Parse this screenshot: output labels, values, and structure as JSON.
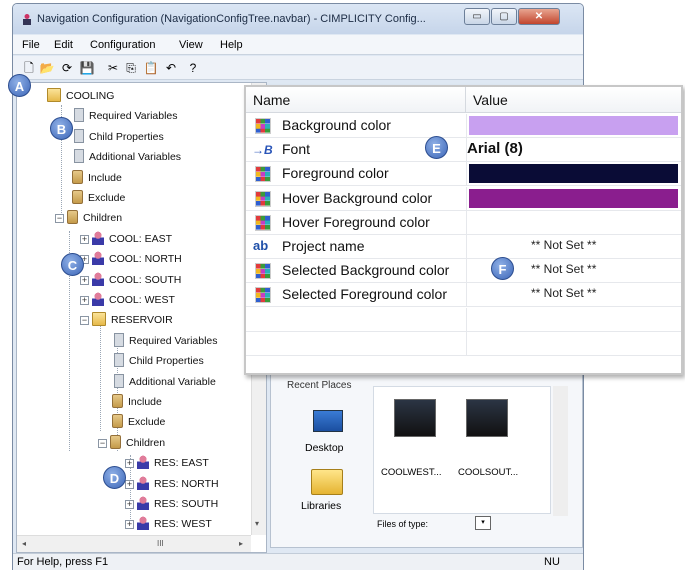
{
  "window": {
    "title": "Navigation Configuration (NavigationConfigTree.navbar) - CIMPLICITY Config...",
    "controls": {
      "minimize": "▭",
      "maximize": "▢",
      "close": "✕"
    }
  },
  "menu": [
    "File",
    "Edit",
    "Configuration",
    "View",
    "Help"
  ],
  "toolbar": {
    "icons": [
      "new-icon",
      "open-icon",
      "refresh-icon",
      "save-icon",
      "cut-icon",
      "copy-icon",
      "paste-icon",
      "undo-icon",
      "help-icon"
    ],
    "glyphs": [
      "🗋",
      "📂",
      "⟳",
      "💾",
      "✂",
      "⎘",
      "📋",
      "↶",
      "?"
    ]
  },
  "tree": [
    {
      "label": "COOLING",
      "icon": "folder-icon"
    },
    {
      "label": "Required Variables",
      "icon": "variable-icon"
    },
    {
      "label": "Child Properties",
      "icon": "variable-icon"
    },
    {
      "label": "Additional Variables",
      "icon": "variable-icon"
    },
    {
      "label": "Include",
      "icon": "include-icon"
    },
    {
      "label": "Exclude",
      "icon": "exclude-icon"
    },
    {
      "label": "Children",
      "icon": "children-icon"
    },
    {
      "label": "COOL: EAST",
      "icon": "user-icon"
    },
    {
      "label": "COOL: NORTH",
      "icon": "user-icon"
    },
    {
      "label": "COOL: SOUTH",
      "icon": "user-icon"
    },
    {
      "label": "COOL: WEST",
      "icon": "user-icon"
    },
    {
      "label": "RESERVOIR",
      "icon": "folder-icon"
    },
    {
      "label": "Required Variables",
      "icon": "variable-icon"
    },
    {
      "label": "Child Properties",
      "icon": "variable-icon"
    },
    {
      "label": "Additional Variable",
      "icon": "variable-icon"
    },
    {
      "label": "Include",
      "icon": "include-icon"
    },
    {
      "label": "Exclude",
      "icon": "exclude-icon"
    },
    {
      "label": "Children",
      "icon": "children-icon"
    },
    {
      "label": "RES: EAST",
      "icon": "user-icon"
    },
    {
      "label": "RES: NORTH",
      "icon": "user-icon"
    },
    {
      "label": "RES: SOUTH",
      "icon": "user-icon"
    },
    {
      "label": "RES: WEST",
      "icon": "user-icon"
    }
  ],
  "tree_scrollbar": {
    "hscroll_grip": "III",
    "left_arrow": "◂",
    "right_arrow": "▸",
    "down_arrow": "▾"
  },
  "properties": {
    "header": {
      "name": "Name",
      "value": "Value"
    },
    "rows": [
      {
        "name": "Background color",
        "icon": "color-grid-icon",
        "value": "",
        "swatch": "#c8a0f0"
      },
      {
        "name": "Font",
        "icon": "font-icon",
        "icon_text": "→B",
        "value": "Arial (8)",
        "swatch": ""
      },
      {
        "name": "Foreground color",
        "icon": "color-grid-icon",
        "value": "",
        "swatch": "#0a0c36"
      },
      {
        "name": "Hover Background color",
        "icon": "color-grid-icon",
        "value": "",
        "swatch": "#8a1e8e"
      },
      {
        "name": "Hover Foreground color",
        "icon": "color-grid-icon",
        "value": "",
        "swatch": ""
      },
      {
        "name": "Project name",
        "icon": "text-icon",
        "icon_text": "ab",
        "value": "** Not Set **",
        "swatch": ""
      },
      {
        "name": "Selected Background color",
        "icon": "color-grid-icon",
        "value": "** Not Set **",
        "swatch": ""
      },
      {
        "name": "Selected Foreground color",
        "icon": "color-grid-icon",
        "value": "** Not Set **",
        "swatch": ""
      }
    ]
  },
  "file_dialog": {
    "recent_places": "Recent Places",
    "desktop": "Desktop",
    "libraries": "Libraries",
    "files": [
      "COOLWEST...",
      "COOLSOUT..."
    ],
    "files_of_type": "Files of type:",
    "dropdown_arrow": "▾"
  },
  "status": {
    "text": "For Help, press F1",
    "indicator": "NU"
  },
  "callouts": [
    "A",
    "B",
    "C",
    "D",
    "E",
    "F"
  ]
}
